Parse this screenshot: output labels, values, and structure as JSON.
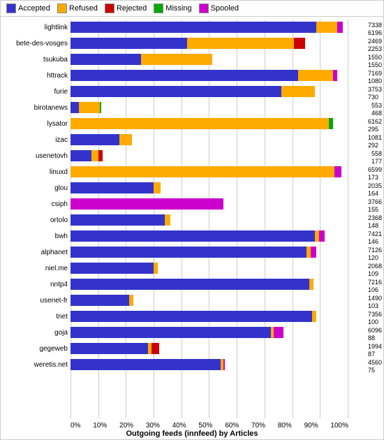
{
  "legend": {
    "items": [
      {
        "label": "Accepted",
        "color": "#3333cc",
        "name": "accepted"
      },
      {
        "label": "Refused",
        "color": "#ffaa00",
        "name": "refused"
      },
      {
        "label": "Rejected",
        "color": "#cc0000",
        "name": "rejected"
      },
      {
        "label": "Missing",
        "color": "#00aa00",
        "name": "missing"
      },
      {
        "label": "Spooled",
        "color": "#cc00cc",
        "name": "spooled"
      }
    ]
  },
  "xaxis": {
    "labels": [
      "0%",
      "10%",
      "20%",
      "30%",
      "40%",
      "50%",
      "60%",
      "70%",
      "80%",
      "90%",
      "100%"
    ],
    "title": "Outgoing feeds (innfeed) by Articles"
  },
  "bars": [
    {
      "label": "lightlink",
      "accepted": 88.5,
      "refused": 7.5,
      "rejected": 0,
      "missing": 0,
      "spooled": 2.0,
      "nums": [
        "7338",
        "6196"
      ]
    },
    {
      "label": "bete-des-vosges",
      "accepted": 42,
      "refused": 38.5,
      "rejected": 4.0,
      "missing": 0,
      "spooled": 0,
      "nums": [
        "2469",
        "2253"
      ]
    },
    {
      "label": "tsukuba",
      "accepted": 25.5,
      "refused": 25.5,
      "rejected": 0,
      "missing": 0,
      "spooled": 0,
      "nums": [
        "1550",
        "1550"
      ]
    },
    {
      "label": "httrack",
      "accepted": 82,
      "refused": 12.5,
      "rejected": 0,
      "missing": 0,
      "spooled": 1.5,
      "nums": [
        "7169",
        "1080"
      ]
    },
    {
      "label": "furie",
      "accepted": 76,
      "refused": 12.0,
      "rejected": 0,
      "missing": 0,
      "spooled": 0,
      "nums": [
        "3753",
        "730"
      ]
    },
    {
      "label": "birotanews",
      "accepted": 3.0,
      "refused": 7.5,
      "rejected": 0,
      "missing": 0.5,
      "spooled": 0,
      "nums": [
        "553",
        "468"
      ]
    },
    {
      "label": "lysator",
      "accepted": 0,
      "refused": 93,
      "rejected": 0,
      "missing": 1.5,
      "spooled": 0,
      "nums": [
        "6162",
        "295"
      ]
    },
    {
      "label": "izac",
      "accepted": 17.5,
      "refused": 4.5,
      "rejected": 0,
      "missing": 0,
      "spooled": 0,
      "nums": [
        "1081",
        "292"
      ]
    },
    {
      "label": "usenetovh",
      "accepted": 7.5,
      "refused": 2.5,
      "rejected": 1.5,
      "missing": 0,
      "spooled": 0,
      "nums": [
        "558",
        "177"
      ]
    },
    {
      "label": "linuxd",
      "accepted": 0,
      "refused": 95,
      "rejected": 0,
      "missing": 0,
      "spooled": 2.5,
      "nums": [
        "6599",
        "173"
      ]
    },
    {
      "label": "glou",
      "accepted": 30,
      "refused": 2.5,
      "rejected": 0,
      "missing": 0,
      "spooled": 0,
      "nums": [
        "2035",
        "164"
      ]
    },
    {
      "label": "csiph",
      "accepted": 0,
      "refused": 0,
      "rejected": 0,
      "missing": 0,
      "spooled": 55.0,
      "nums": [
        "3766",
        "155"
      ]
    },
    {
      "label": "ortolo",
      "accepted": 34,
      "refused": 2.0,
      "rejected": 0,
      "missing": 0,
      "spooled": 0,
      "nums": [
        "2368",
        "148"
      ]
    },
    {
      "label": "bwh",
      "accepted": 88,
      "refused": 1.5,
      "rejected": 0,
      "missing": 0,
      "spooled": 2.0,
      "nums": [
        "7421",
        "146"
      ]
    },
    {
      "label": "alphanet",
      "accepted": 85,
      "refused": 1.5,
      "rejected": 0,
      "missing": 0,
      "spooled": 2.0,
      "nums": [
        "7126",
        "120"
      ]
    },
    {
      "label": "niel.me",
      "accepted": 30,
      "refused": 1.5,
      "rejected": 0,
      "missing": 0,
      "spooled": 0,
      "nums": [
        "2068",
        "109"
      ]
    },
    {
      "label": "nntp4",
      "accepted": 86,
      "refused": 1.5,
      "rejected": 0,
      "missing": 0,
      "spooled": 0,
      "nums": [
        "7216",
        "106"
      ]
    },
    {
      "label": "usenet-fr",
      "accepted": 21,
      "refused": 1.5,
      "rejected": 0,
      "missing": 0,
      "spooled": 0,
      "nums": [
        "1490",
        "103"
      ]
    },
    {
      "label": "tnet",
      "accepted": 87,
      "refused": 1.5,
      "rejected": 0,
      "missing": 0,
      "spooled": 0,
      "nums": [
        "7356",
        "100"
      ]
    },
    {
      "label": "goja",
      "accepted": 72,
      "refused": 1.2,
      "rejected": 0,
      "missing": 0,
      "spooled": 3.5,
      "nums": [
        "6096",
        "88"
      ]
    },
    {
      "label": "gegeweb",
      "accepted": 28,
      "refused": 1.2,
      "rejected": 2.8,
      "missing": 0,
      "spooled": 0,
      "nums": [
        "1994",
        "87"
      ]
    },
    {
      "label": "weretis.net",
      "accepted": 54,
      "refused": 1.0,
      "rejected": 0,
      "missing": 0,
      "spooled": 0.5,
      "nums": [
        "4560",
        "75"
      ]
    }
  ]
}
